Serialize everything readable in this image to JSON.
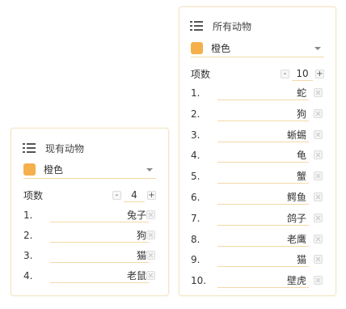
{
  "accent_color": "#f5b04b",
  "left_panel": {
    "title": "现有动物",
    "title_icon": "list-icon",
    "color_value": "橙色",
    "count_label": "项数",
    "count": "4",
    "items": [
      {
        "index": "1.",
        "value": "兔子"
      },
      {
        "index": "2.",
        "value": "狗"
      },
      {
        "index": "3.",
        "value": "猫"
      },
      {
        "index": "4.",
        "value": "老鼠"
      }
    ]
  },
  "right_panel": {
    "title": "所有动物",
    "title_icon": "list-icon",
    "color_value": "橙色",
    "count_label": "项数",
    "count": "10",
    "items": [
      {
        "index": "1.",
        "value": "蛇"
      },
      {
        "index": "2.",
        "value": "狗"
      },
      {
        "index": "3.",
        "value": "蜥蜴"
      },
      {
        "index": "4.",
        "value": "龟"
      },
      {
        "index": "5.",
        "value": "蟹"
      },
      {
        "index": "6.",
        "value": "鳄鱼"
      },
      {
        "index": "7.",
        "value": "鸽子"
      },
      {
        "index": "8.",
        "value": "老鹰"
      },
      {
        "index": "9.",
        "value": "猫"
      },
      {
        "index": "10.",
        "value": "壁虎"
      }
    ]
  },
  "stepper": {
    "minus": "-",
    "plus": "+"
  }
}
